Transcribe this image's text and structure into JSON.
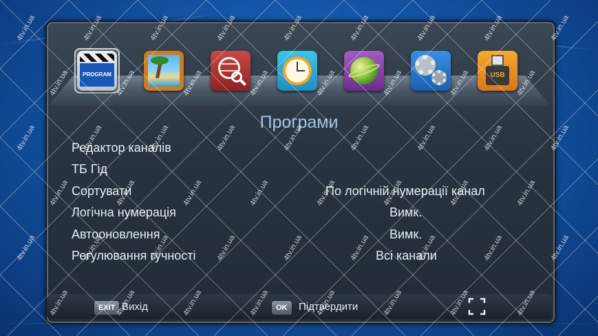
{
  "menu": {
    "icons": [
      {
        "name": "program-icon",
        "caption": "PROGRAM",
        "selected": true
      },
      {
        "name": "picture-icon",
        "selected": false
      },
      {
        "name": "globe-search-icon",
        "selected": false
      },
      {
        "name": "clock-icon",
        "selected": false
      },
      {
        "name": "earth-icon",
        "selected": false
      },
      {
        "name": "gears-icon",
        "selected": false
      },
      {
        "name": "usb-icon",
        "caption": "USB",
        "selected": false
      }
    ]
  },
  "page": {
    "title": "Програми",
    "rows": [
      {
        "label": "Редактор каналів",
        "value": ""
      },
      {
        "label": "ТБ Гід",
        "value": ""
      },
      {
        "label": "Сортувати",
        "value": "По логічній нумерації канал"
      },
      {
        "label": "Логічна нумерація",
        "value": "Вимк."
      },
      {
        "label": "Автооновлення",
        "value": "Вимк."
      },
      {
        "label": "Регулювання гучності",
        "value": "Всі канали"
      }
    ]
  },
  "footer": {
    "exit_key": "EXIT",
    "exit_label": "Вихід",
    "ok_key": "OK",
    "ok_label": "Підтвердити"
  },
  "watermark": {
    "text": "4tv.in.ua"
  },
  "colors": {
    "title": "#9fc3ea",
    "text": "#e8eef4",
    "panel": "#2a3440",
    "background": "#1356a8"
  }
}
